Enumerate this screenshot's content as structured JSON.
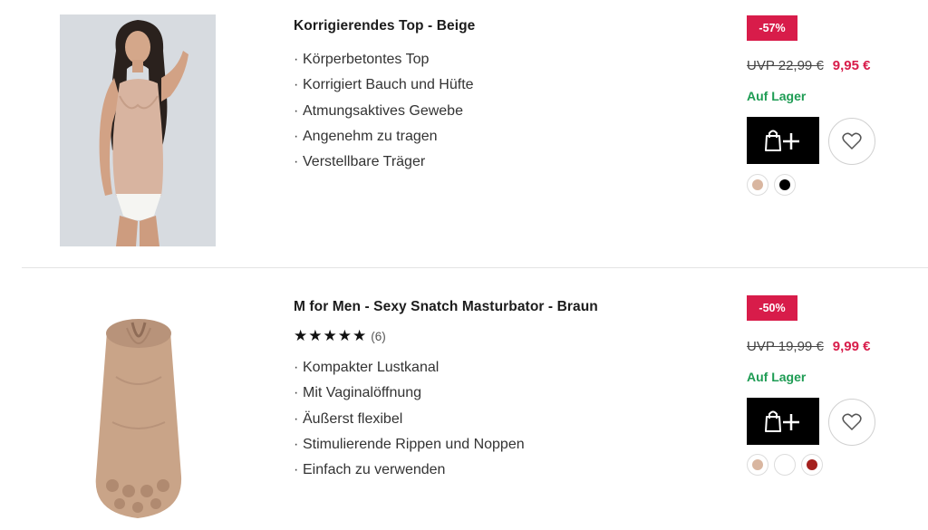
{
  "products": [
    {
      "title": "Korrigierendes Top - Beige",
      "image_alt": "woman-wearing-beige-shaping-top",
      "features": [
        "Körperbetontes Top",
        "Korrigiert Bauch und Hüfte",
        "Atmungsaktives Gewebe",
        "Angenehm zu tragen",
        "Verstellbare Träger"
      ],
      "bullet": "·",
      "discount": "-57%",
      "uvp": "UVP 22,99 €",
      "price": "9,95 €",
      "stock": "Auf Lager",
      "colors": [
        "#d9b6a0",
        "#000000"
      ]
    },
    {
      "title": "M for Men - Sexy Snatch Masturbator - Braun",
      "image_alt": "beige-masturbator-sleeve",
      "stars": "★★★★★",
      "rating_count": "(6)",
      "features": [
        "Kompakter Lustkanal",
        "Mit Vaginalöffnung",
        "Äußerst flexibel",
        "Stimulierende Rippen und Noppen",
        "Einfach zu verwenden"
      ],
      "bullet": "·",
      "discount": "-50%",
      "uvp": "UVP 19,99 €",
      "price": "9,99 €",
      "stock": "Auf Lager",
      "colors": [
        "#d9b6a0",
        "#ffffff",
        "#a5211e"
      ]
    }
  ],
  "colors": {
    "accent": "#d81c4a",
    "stock": "#1e9c54",
    "button": "#000000"
  }
}
